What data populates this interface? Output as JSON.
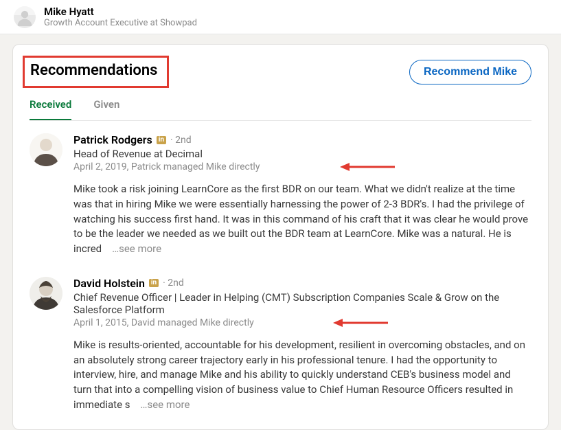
{
  "header": {
    "name": "Mike Hyatt",
    "subtitle": "Growth Account Executive at Showpad"
  },
  "section": {
    "title": "Recommendations",
    "recommend_button": "Recommend Mike"
  },
  "tabs": {
    "received": "Received",
    "given": "Given"
  },
  "recommendations": [
    {
      "name": "Patrick Rodgers",
      "badge": "in",
      "degree": "· 2nd",
      "title": "Head of Revenue at Decimal",
      "meta": "April 2, 2019, Patrick managed Mike directly",
      "body": "Mike took a risk joining LearnCore as the first BDR on our team. What we didn't realize at the time was that in hiring Mike we were essentially harnessing the power of 2-3 BDR's. I had the privilege of watching his success first hand. It was in this command of his craft that it was clear he would prove to be the leader we needed as we built out the BDR team at LearnCore. Mike was a natural. He is incred",
      "see_more": "…see more"
    },
    {
      "name": "David Holstein",
      "badge": "in",
      "degree": "· 2nd",
      "title": "Chief Revenue Officer | Leader in Helping (CMT) Subscription Companies Scale & Grow on the Salesforce Platform",
      "meta": "April 1, 2015, David managed Mike directly",
      "body": "Mike is results-oriented, accountable for his development, resilient in overcoming obstacles, and on an absolutely strong career trajectory early in his professional tenure. I had the opportunity to interview, hire, and manage Mike and his ability to quickly understand CEB's business model and turn that into a compelling vision of business value to Chief Human Resource Officers resulted in immediate s",
      "see_more": "…see more"
    }
  ],
  "annotations": {
    "highlight_color": "#e13a30",
    "arrow_color": "#e13a30"
  }
}
